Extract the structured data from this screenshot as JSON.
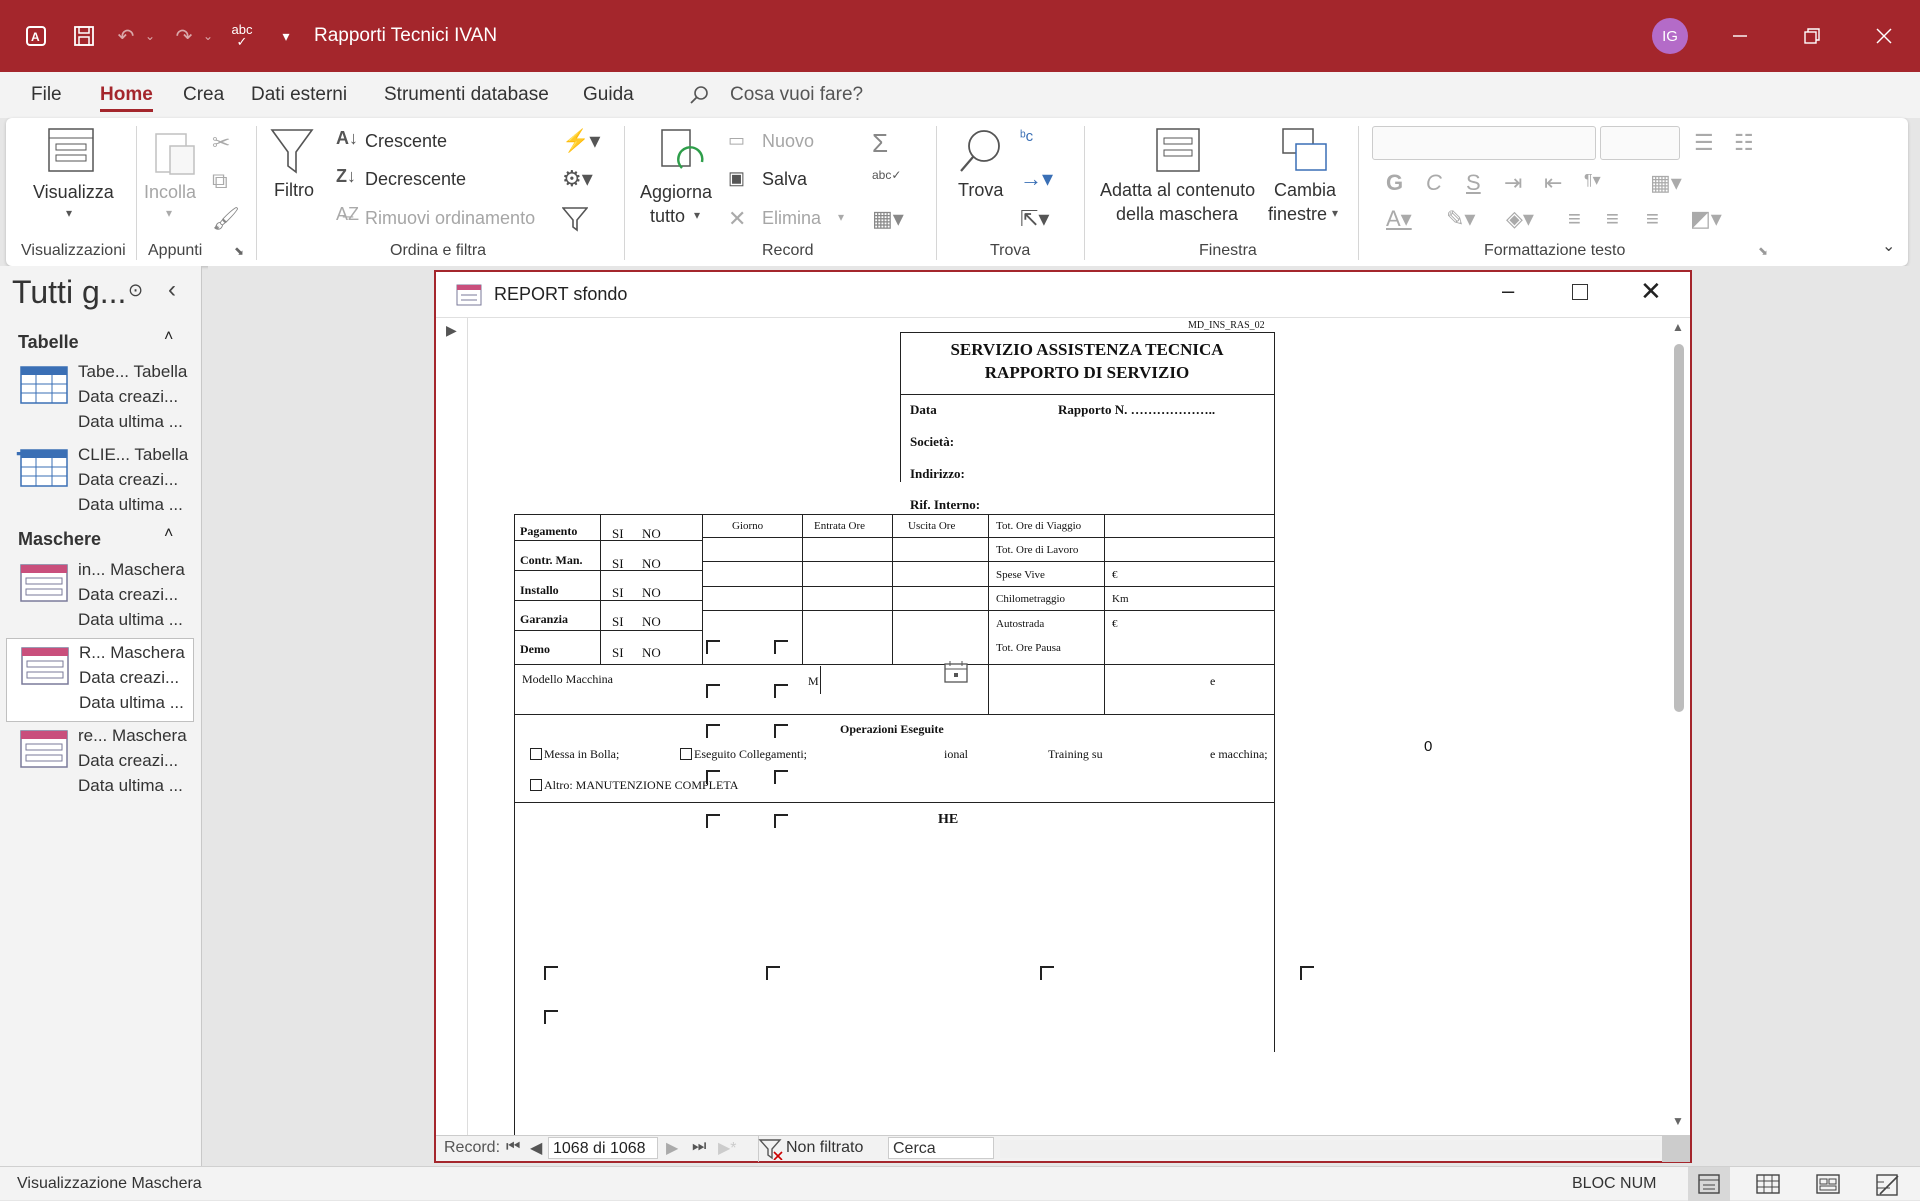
{
  "titlebar": {
    "title": "Rapporti Tecnici IVAN",
    "avatar": "IG",
    "icons": [
      "access-logo-icon",
      "save-icon",
      "undo-icon",
      "redo-icon",
      "spellcheck-icon",
      "customize-icon"
    ]
  },
  "menu": {
    "items": [
      "File",
      "Home",
      "Crea",
      "Dati esterni",
      "Strumenti database",
      "Guida"
    ],
    "active": "Home",
    "search_placeholder": "Cosa vuoi fare?"
  },
  "ribbon": {
    "groups": {
      "visualizzazioni": "Visualizzazioni",
      "appunti": "Appunti",
      "ordina": "Ordina e filtra",
      "record": "Record",
      "trova": "Trova",
      "finestra": "Finestra",
      "formattazione": "Formattazione testo"
    },
    "visualizza": "Visualizza",
    "incolla": "Incolla",
    "filtro": "Filtro",
    "crescente": "Crescente",
    "decrescente": "Decrescente",
    "rimuovi": "Rimuovi ordinamento",
    "aggiorna1": "Aggiorna",
    "aggiorna2": "tutto",
    "nuovo": "Nuovo",
    "salva": "Salva",
    "elimina": "Elimina",
    "trova": "Trova",
    "adatta1": "Adatta al contenuto",
    "adatta2": "della maschera",
    "cambia1": "Cambia",
    "cambia2": "finestre",
    "bold": "G",
    "italic": "C",
    "underline": "S"
  },
  "nav": {
    "title": "Tutti g...",
    "sections": {
      "tabelle": "Tabelle",
      "maschere": "Maschere"
    },
    "items": [
      {
        "name": "Tabe...",
        "type": "Tabella",
        "l2": "Data creazi...",
        "l3": "Data ultima ..."
      },
      {
        "name": "CLIE...",
        "type": "Tabella",
        "l2": "Data creazi...",
        "l3": "Data ultima ..."
      },
      {
        "name": "in...",
        "type": "Maschera",
        "l2": "Data creazi...",
        "l3": "Data ultima ..."
      },
      {
        "name": "R...",
        "type": "Maschera",
        "l2": "Data creazi...",
        "l3": "Data ultima ..."
      },
      {
        "name": "re...",
        "type": "Maschera",
        "l2": "Data creazi...",
        "l3": "Data ultima ..."
      }
    ]
  },
  "form": {
    "title": "REPORT sfondo",
    "doc": {
      "code": "MD_INS_RAS_02",
      "h1": "SERVIZIO ASSISTENZA TECNICA",
      "h2": "RAPPORTO DI SERVIZIO",
      "data": "Data",
      "rapporto": "Rapporto N. ………………..",
      "societa": "Società:",
      "indirizzo": "Indirizzo:",
      "rif": "Rif. Interno:",
      "rows": [
        "Pagamento",
        "Contr. Man.",
        "Installo",
        "Garanzia",
        "Demo"
      ],
      "si": "SI",
      "no": "NO",
      "cols": [
        "Giorno",
        "Entrata Ore",
        "Uscita Ore"
      ],
      "right": [
        "Tot. Ore di Viaggio",
        "Tot. Ore di Lavoro",
        "Spese Vive",
        "Chilometraggio",
        "Autostrada",
        "Tot. Ore Pausa"
      ],
      "right_vals": [
        "",
        "",
        "€",
        "Km",
        "€",
        ""
      ],
      "modello": "Modello Macchina",
      "m": "M",
      "e": "e",
      "operazioni": "Operazioni Eseguite",
      "messa": "Messa in Bolla;",
      "collegamenti": "Eseguito Collegamenti;",
      "ional": "ional",
      "training": "Training su",
      "macchina": "e macchina;",
      "altro": "Altro: MANUTENZIONE COMPLETA",
      "he": "HE",
      "zero": "0"
    },
    "recbar": {
      "label": "Record:",
      "position": "1068 di 1068",
      "filter": "Non filtrato",
      "search": "Cerca"
    }
  },
  "status": {
    "left": "Visualizzazione Maschera",
    "numlock": "BLOC NUM"
  }
}
